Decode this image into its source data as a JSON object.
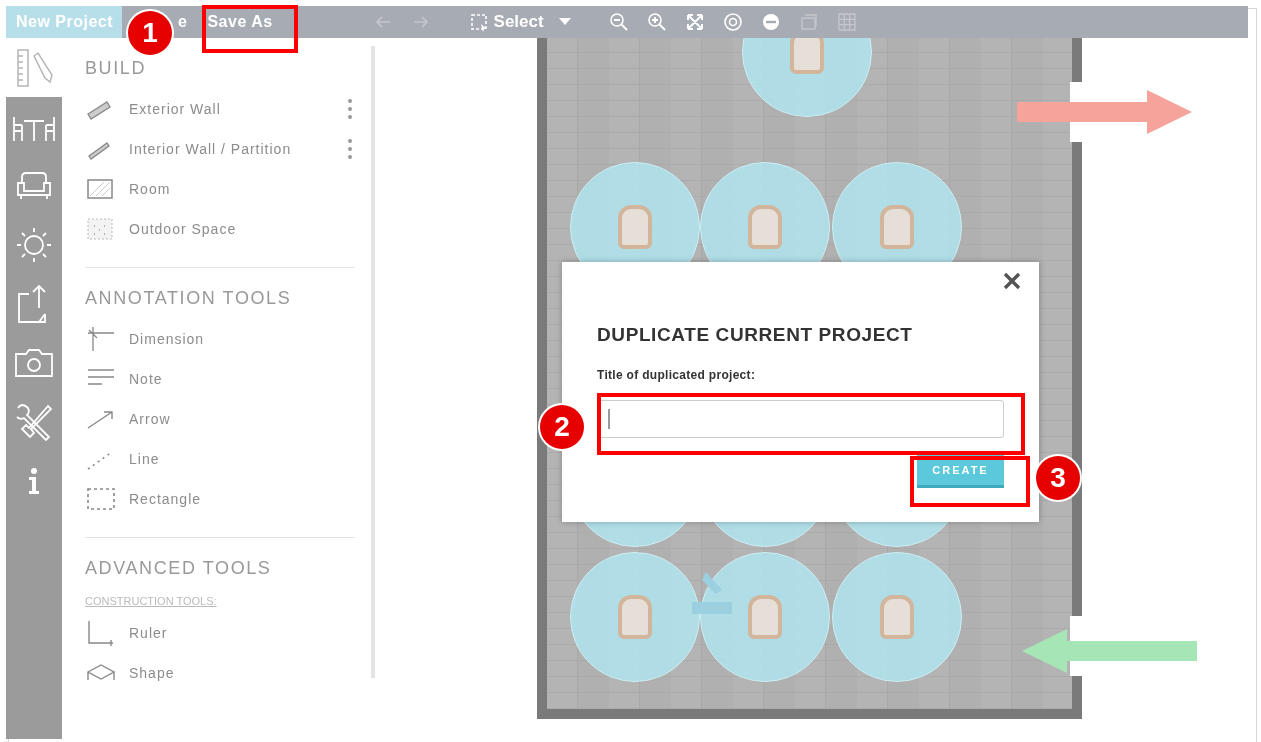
{
  "toolbar": {
    "project_name": "New Project",
    "menu": [
      {
        "label": "e"
      },
      {
        "label": "Save As"
      }
    ],
    "tools": [
      {
        "kind": "arrow-left",
        "disabled": true
      },
      {
        "kind": "arrow-right",
        "disabled": true
      },
      {
        "kind": "select",
        "label": "Select",
        "disabled": false
      },
      {
        "kind": "zoom-out",
        "disabled": false
      },
      {
        "kind": "zoom-in",
        "disabled": false
      },
      {
        "kind": "fit",
        "disabled": false
      },
      {
        "kind": "target",
        "disabled": false
      },
      {
        "kind": "minus",
        "disabled": false
      },
      {
        "kind": "layers",
        "disabled": true
      },
      {
        "kind": "grid",
        "disabled": true
      }
    ]
  },
  "rail": [
    {
      "kind": "ruler-pencil",
      "selected": true
    },
    {
      "kind": "table-chairs",
      "selected": false
    },
    {
      "kind": "armchair",
      "selected": false
    },
    {
      "kind": "sun",
      "selected": false
    },
    {
      "kind": "export",
      "selected": false
    },
    {
      "kind": "camera",
      "selected": false
    },
    {
      "kind": "tools",
      "selected": false
    },
    {
      "kind": "info",
      "selected": false
    }
  ],
  "panel": {
    "sections": [
      {
        "title": "BUILD",
        "items": [
          {
            "label": "Exterior Wall",
            "kind": "exterior-wall",
            "has_menu": true
          },
          {
            "label": "Interior Wall / Partition",
            "kind": "interior-wall",
            "has_menu": true
          },
          {
            "label": "Room",
            "kind": "room",
            "has_menu": false
          },
          {
            "label": "Outdoor Space",
            "kind": "outdoor",
            "has_menu": false
          }
        ]
      },
      {
        "title": "ANNOTATION TOOLS",
        "items": [
          {
            "label": "Dimension",
            "kind": "dimension",
            "has_menu": false
          },
          {
            "label": "Note",
            "kind": "note",
            "has_menu": false
          },
          {
            "label": "Arrow",
            "kind": "arrow",
            "has_menu": false
          },
          {
            "label": "Line",
            "kind": "line",
            "has_menu": false
          },
          {
            "label": "Rectangle",
            "kind": "rectangle",
            "has_menu": false
          }
        ]
      },
      {
        "title": "ADVANCED TOOLS",
        "subtitle": "CONSTRUCTION TOOLS:",
        "items": [
          {
            "label": "Ruler",
            "kind": "ruler",
            "has_menu": false
          },
          {
            "label": "Shape",
            "kind": "shape",
            "has_menu": false
          }
        ]
      }
    ]
  },
  "plan": {
    "arrows": [
      {
        "kind": "out",
        "color": "#f6a39b"
      },
      {
        "kind": "in",
        "color": "#a6e5b6"
      }
    ]
  },
  "dialog": {
    "title": "DUPLICATE CURRENT PROJECT",
    "field_label": "Title of duplicated project:",
    "button": "CREATE"
  },
  "annotations": [
    {
      "number": "1"
    },
    {
      "number": "2"
    },
    {
      "number": "3"
    }
  ]
}
